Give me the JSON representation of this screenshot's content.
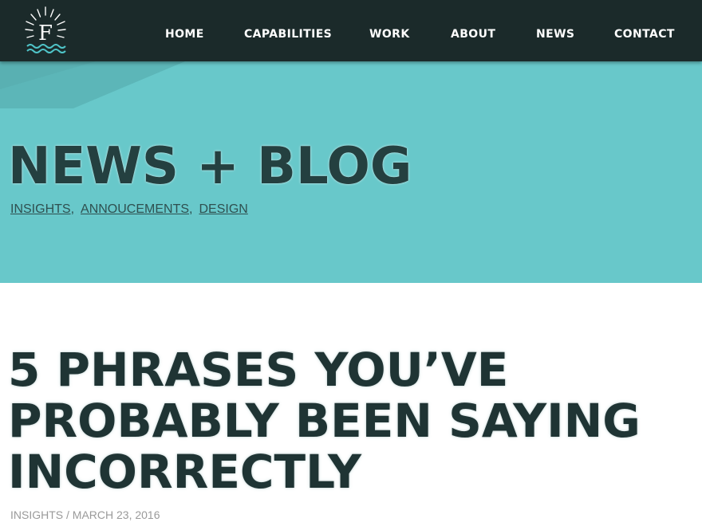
{
  "brand": {
    "logo_letter": "F",
    "logo_icon": "sunburst-waves-logo-icon"
  },
  "nav": {
    "items": [
      {
        "label": "HOME"
      },
      {
        "label": "CAPABILITIES"
      },
      {
        "label": "WORK"
      },
      {
        "label": "ABOUT"
      },
      {
        "label": "NEWS"
      },
      {
        "label": "CONTACT"
      }
    ]
  },
  "hero": {
    "title": "NEWS + BLOG",
    "categories": [
      {
        "label": "INSIGHTS"
      },
      {
        "label": "ANNOUCEMENTS"
      },
      {
        "label": "DESIGN"
      }
    ],
    "separator": ","
  },
  "post": {
    "title": "5 PHRASES YOU’VE PROBABLY BEEN SAYING INCORRECTLY",
    "meta": "INSIGHTS / MARCH 23, 2016"
  },
  "colors": {
    "topbar": "#1b2a2a",
    "hero_bg": "#68c8ca",
    "heading_text": "#244040",
    "meta_text": "#9a9a9a",
    "logo_waves": "#4fc4c8"
  }
}
